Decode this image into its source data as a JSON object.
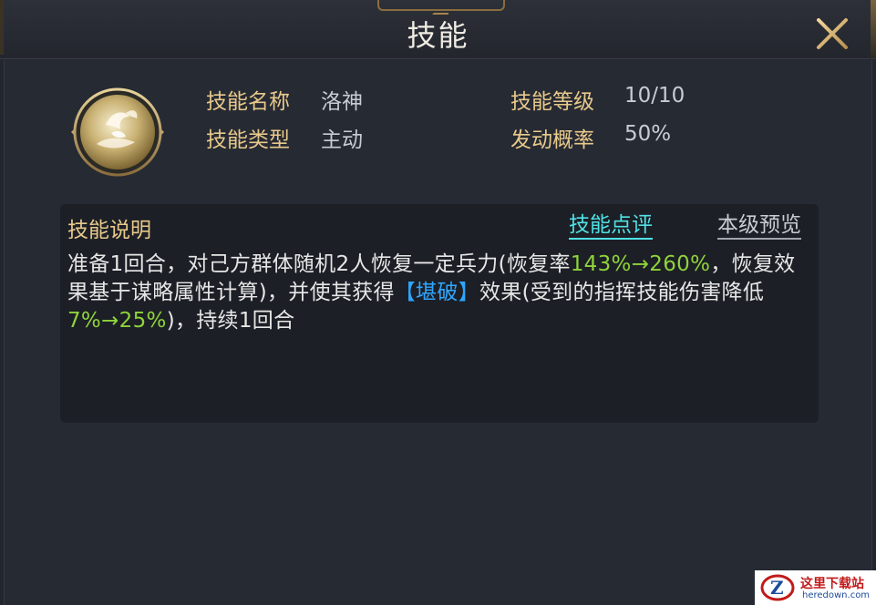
{
  "window": {
    "title": "技能",
    "close_icon": "close-x-icon"
  },
  "skill": {
    "icon": "luoshen-skill-icon",
    "fields": [
      {
        "label": "技能名称",
        "value": "洛神"
      },
      {
        "label": "技能类型",
        "value": "主动"
      },
      {
        "label": "技能等级",
        "value": "10/10"
      },
      {
        "label": "发动概率",
        "value": "50%"
      }
    ]
  },
  "description": {
    "title": "技能说明",
    "review_link": "技能点评",
    "preview_link": "本级预览",
    "segments": [
      {
        "text": "准备1回合，对己方群体随机2人恢复一定兵力(恢复率",
        "style": "normal"
      },
      {
        "text": "143%→260%",
        "style": "green"
      },
      {
        "text": "，恢复效果基于谋略属性计算)，并使其获得",
        "style": "normal"
      },
      {
        "text": "【堪破】",
        "style": "blue"
      },
      {
        "text": "效果(受到的指挥技能伤害降低",
        "style": "normal"
      },
      {
        "text": "7%→25%",
        "style": "green"
      },
      {
        "text": ")，持续1回合",
        "style": "normal"
      }
    ]
  },
  "colors": {
    "label_gold": "#e8c98b",
    "value_gray": "#c9ccd2",
    "highlight_green": "#8fd33a",
    "highlight_blue": "#2fa6ff",
    "link_cyan": "#4fe2e6"
  },
  "watermark": {
    "cn": "这里下载站",
    "en": "heredown.com"
  }
}
